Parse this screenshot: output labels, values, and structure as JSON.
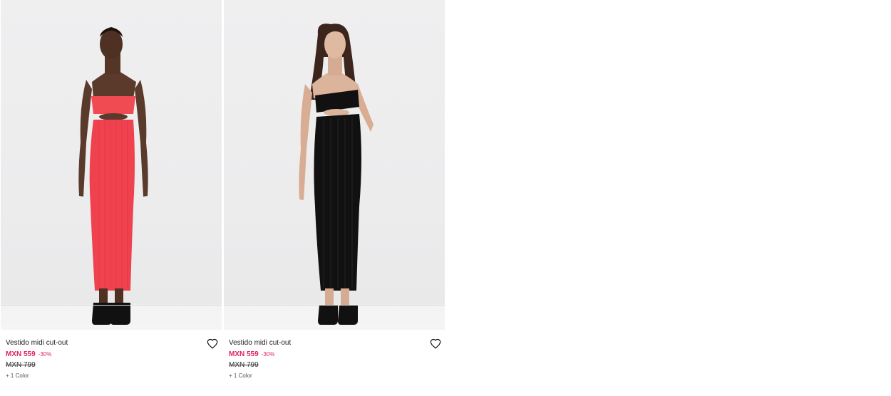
{
  "products": [
    {
      "name": "Vestido midi cut-out",
      "price": "MXN 559",
      "discount": "-30%",
      "old_price": "MXN 799",
      "colors": "+ 1 Color",
      "dress_color": "#f0424e",
      "image_alt": "Model wearing coral strapless ribbed midi dress with cut-out"
    },
    {
      "name": "Vestido midi cut-out",
      "price": "MXN 559",
      "discount": "-30%",
      "old_price": "MXN 799",
      "colors": "+ 1 Color",
      "dress_color": "#111111",
      "image_alt": "Model wearing black strapless ribbed midi dress with cut-out"
    }
  ],
  "colors": {
    "sale": "#e0245e",
    "background": "#ffffff"
  }
}
